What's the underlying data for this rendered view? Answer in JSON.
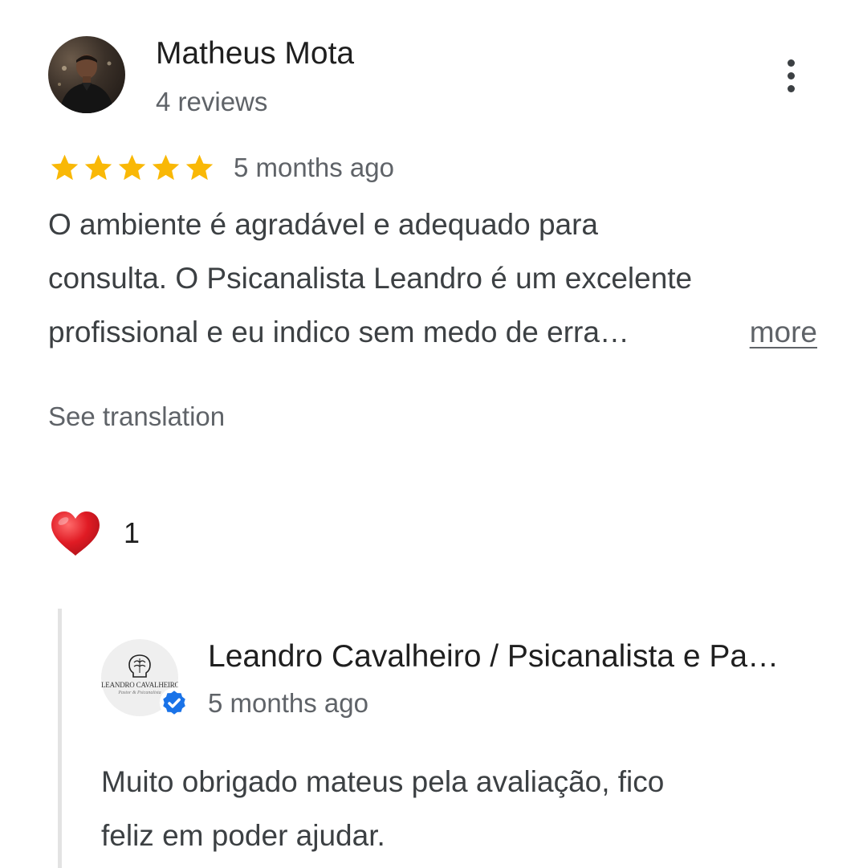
{
  "review": {
    "reviewer_name": "Matheus Mota",
    "reviewer_meta": "4 reviews",
    "rating": 5,
    "rating_max": 5,
    "time_ago": "5 months ago",
    "text_lines": [
      "O ambiente é agradável e adequado para",
      "consulta. O Psicanalista Leandro é um excelente",
      "profissional e eu indico sem medo de erra…"
    ],
    "more_label": "more",
    "see_translation_label": "See translation",
    "reaction": {
      "icon": "heart-icon",
      "count": "1"
    },
    "more_options_icon": "more-vert-icon"
  },
  "owner_reply": {
    "owner_name": "Leandro Cavalheiro / Psicanalista e Pa…",
    "time_ago": "5 months ago",
    "avatar_logo_text": "LEANDRO CAVALHEIRO",
    "avatar_logo_subtext": "Pastor & Psicanalista",
    "verified_icon": "verified-badge-icon",
    "text_lines": [
      "Muito obrigado mateus pela avaliação, fico",
      "feliz em poder ajudar."
    ]
  },
  "colors": {
    "star": "#f9b806",
    "heart": "#e01b24",
    "verified": "#1a73e8",
    "secondary_text": "#5f6368",
    "primary_text": "#1f1f1f",
    "reply_bar": "#e3e3e3"
  }
}
